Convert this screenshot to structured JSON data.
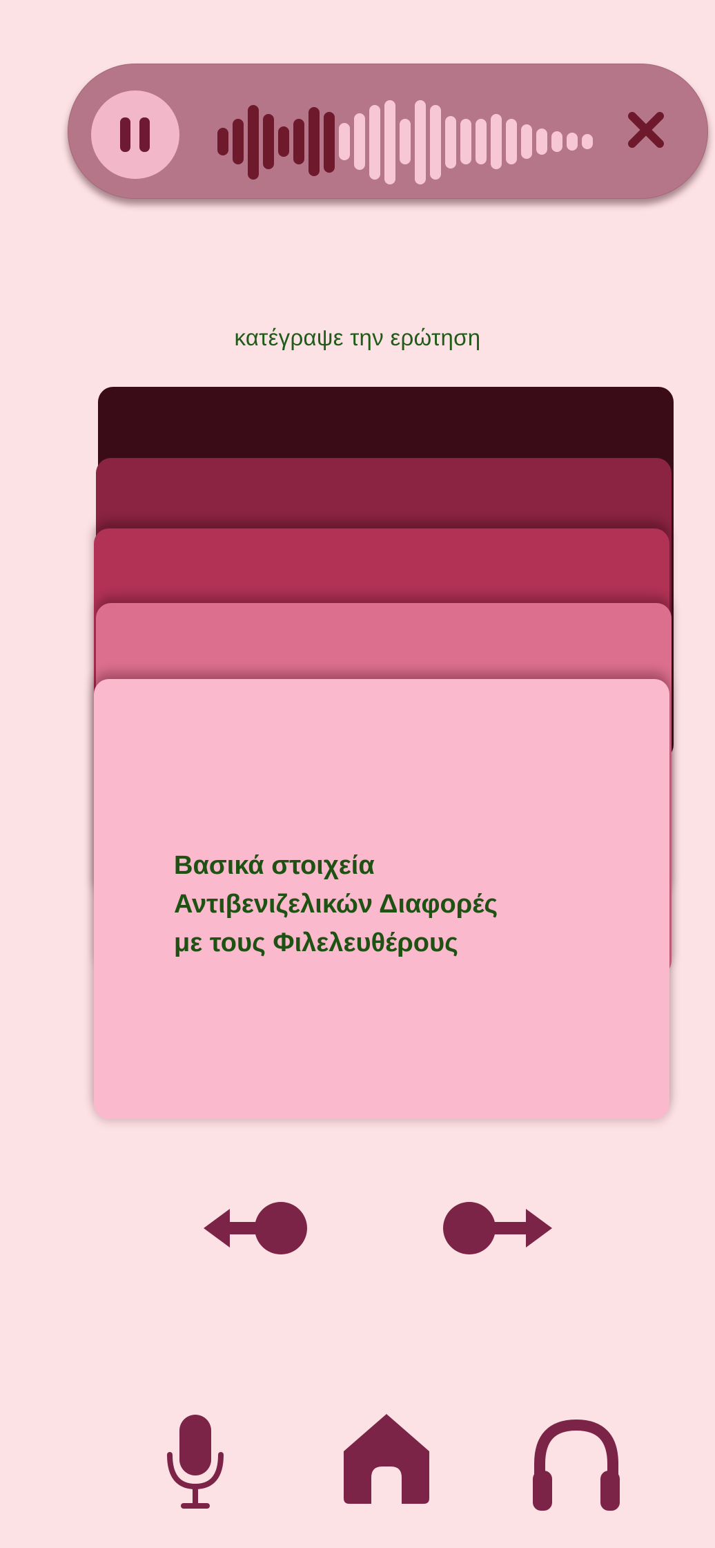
{
  "recorder": {
    "pause_icon": "pause-icon",
    "close_icon": "close-icon",
    "waveform_icon": "audio-waveform"
  },
  "prompt": {
    "text": "κατέγραψε την ερώτηση"
  },
  "card": {
    "text_line_1": "Βασικά στοιχεία",
    "text_line_2": "Αντιβενιζελικών Διαφορές",
    "text_line_3": "με τους Φιλελευθέρους"
  },
  "navigation": {
    "previous_icon": "arrow-left-icon",
    "next_icon": "arrow-right-icon"
  },
  "bottom_bar": {
    "items": [
      "microphone-icon",
      "home-icon",
      "headphones-icon"
    ]
  },
  "colors": {
    "background": "#fde2e5",
    "accent": "#7b2447",
    "text_green": "#1d5212"
  }
}
